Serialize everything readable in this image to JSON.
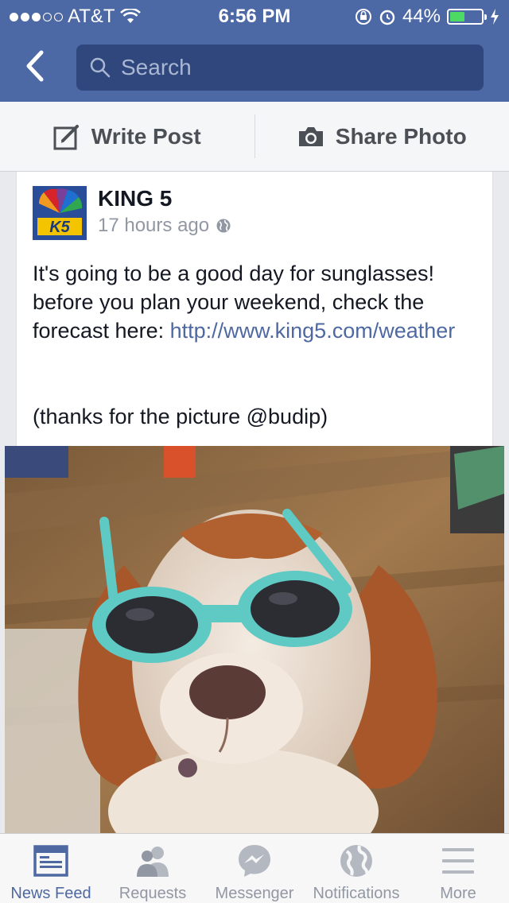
{
  "status": {
    "carrier": "AT&T",
    "time": "6:56 PM",
    "battery": "44%",
    "battery_level": 0.44
  },
  "search": {
    "placeholder": "Search"
  },
  "composer": {
    "write_post": "Write Post",
    "share_photo": "Share Photo"
  },
  "post": {
    "author": "KING 5",
    "avatar_text": "K5",
    "time": "17 hours ago",
    "text_line": "It's going to be a good day for sunglasses! before you plan your weekend, check the forecast here: ",
    "link": "http://www.king5.com/weather",
    "thanks": "(thanks for the picture @budip)"
  },
  "tabs": [
    {
      "label": "News Feed",
      "icon": "news-feed-icon",
      "active": true
    },
    {
      "label": "Requests",
      "icon": "friend-requests-icon",
      "active": false
    },
    {
      "label": "Messenger",
      "icon": "messenger-icon",
      "active": false
    },
    {
      "label": "Notifications",
      "icon": "globe-icon",
      "active": false
    },
    {
      "label": "More",
      "icon": "menu-icon",
      "active": false
    }
  ],
  "colors": {
    "header": "#4d69a5",
    "link": "#4e69a2",
    "active_tab": "#4e69a2",
    "battery_fill": "#4cd964"
  }
}
